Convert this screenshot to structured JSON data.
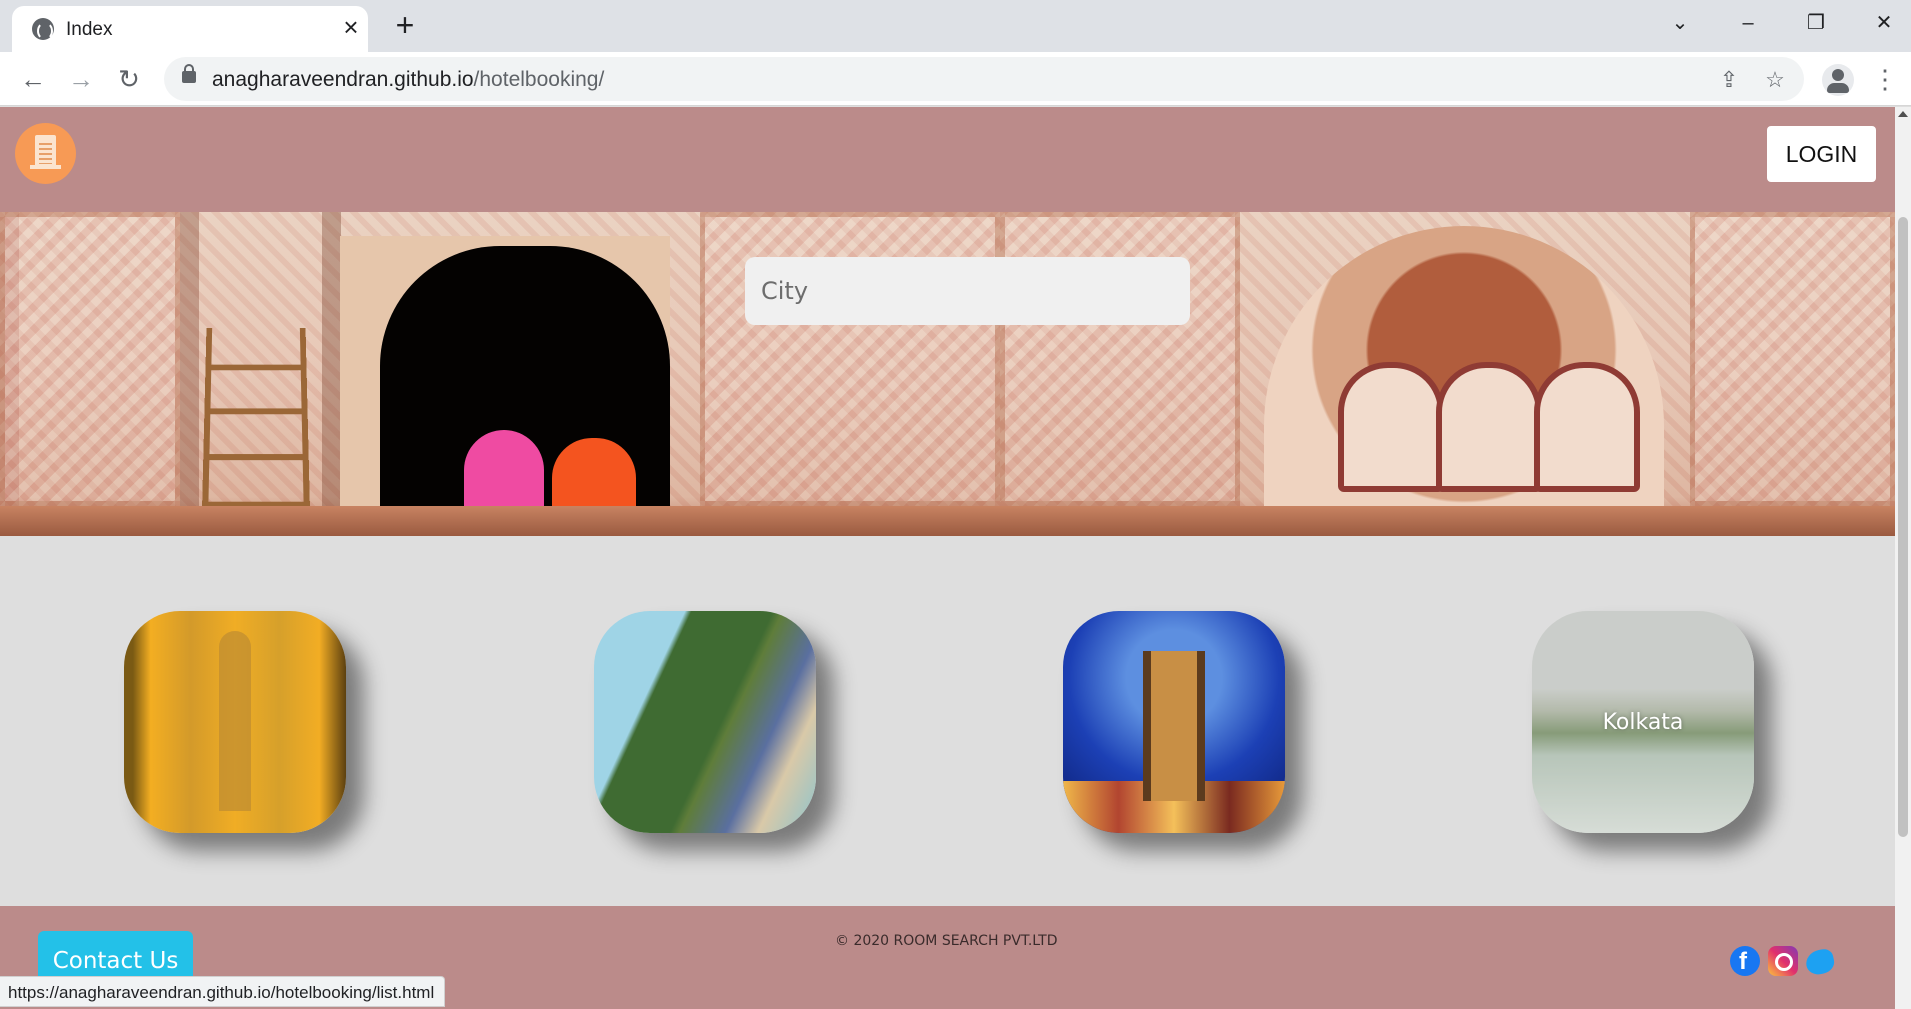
{
  "browser": {
    "tab_title": "Index",
    "url_domain": "anagharaveendran.github.io",
    "url_path": "/hotelbooking/",
    "status_url": "https://anagharaveendran.github.io/hotelbooking/list.html"
  },
  "header": {
    "login_label": "LOGIN"
  },
  "search": {
    "placeholder": "City",
    "value": ""
  },
  "cities": [
    {
      "label": ""
    },
    {
      "label": ""
    },
    {
      "label": ""
    },
    {
      "label": "Kolkata"
    }
  ],
  "footer": {
    "contact_label": "Contact Us",
    "copyright": "© 2020 ROOM SEARCH PVT.LTD"
  },
  "colors": {
    "header_bg": "#bb8b8a",
    "page_bg": "#dedede",
    "contact_button": "#23c1e8"
  },
  "icons": [
    "globe-icon",
    "close-icon",
    "plus-icon",
    "back-icon",
    "forward-icon",
    "reload-icon",
    "lock-icon",
    "share-icon",
    "star-icon",
    "profile-icon",
    "menu-icon",
    "hotel-logo-icon",
    "facebook-icon",
    "instagram-icon",
    "twitter-icon"
  ]
}
